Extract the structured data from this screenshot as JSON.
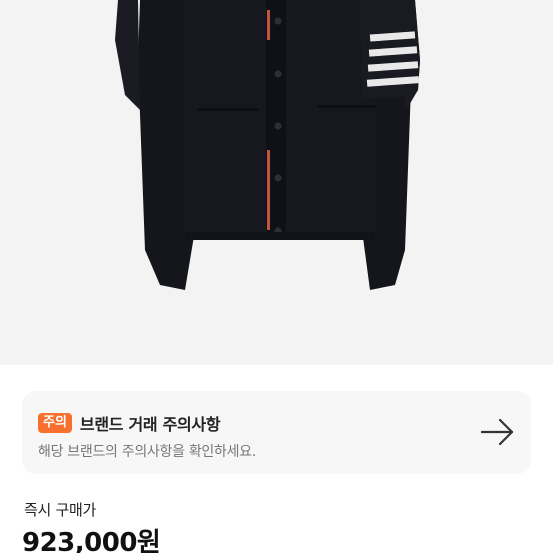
{
  "product": {
    "image_alt": "navy knit cardigan with four white arm stripes"
  },
  "notice": {
    "badge": "주의",
    "title": "브랜드 거래 주의사항",
    "subtitle": "해당 브랜드의 주의사항을 확인하세요.",
    "arrow_icon": "arrow-right-icon",
    "accent": "#f7702e"
  },
  "purchase": {
    "label": "즉시 구매가",
    "price": "923,000원"
  }
}
